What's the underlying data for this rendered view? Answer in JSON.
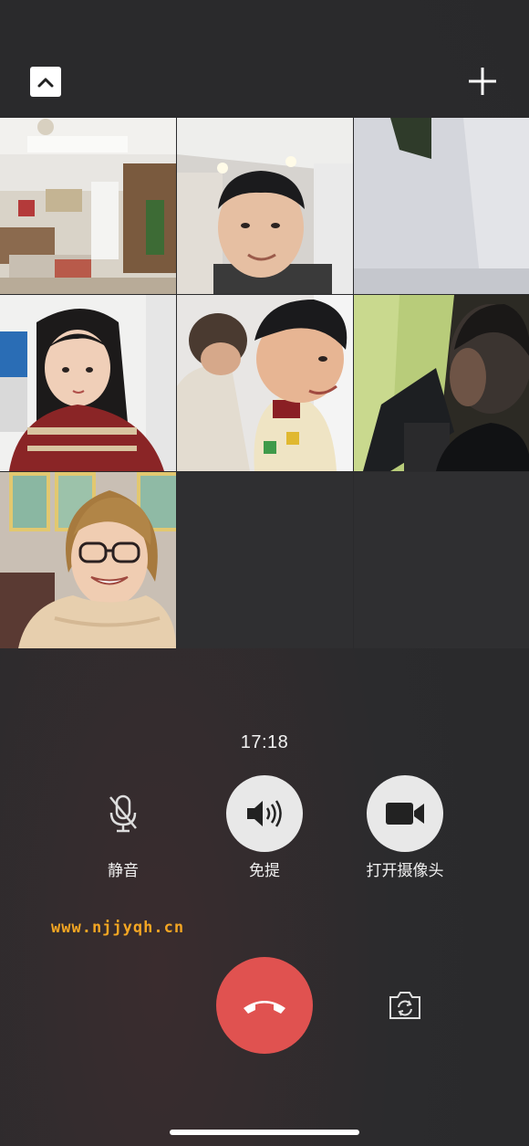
{
  "call": {
    "timer": "17:18"
  },
  "header": {
    "collapse_icon": "chevron-up-icon",
    "add_icon": "plus-icon"
  },
  "participants": [
    {
      "scene": "living-room"
    },
    {
      "scene": "boy-selfie"
    },
    {
      "scene": "white-wall"
    },
    {
      "scene": "girl-sweater"
    },
    {
      "scene": "boy-and-man"
    },
    {
      "scene": "man-dark-room"
    },
    {
      "scene": "woman-glasses"
    }
  ],
  "controls": {
    "mute": {
      "label": "静音",
      "icon": "microphone-icon"
    },
    "speaker": {
      "label": "免提",
      "icon": "speaker-icon"
    },
    "camera": {
      "label": "打开摄像头",
      "icon": "video-camera-icon"
    }
  },
  "watermark": "www.njjyqh.cn",
  "hangup_icon": "hang-up-icon",
  "flip_camera_icon": "flip-camera-icon",
  "colors": {
    "background": "#2b2b2d",
    "hangup": "#e05250",
    "watermark": "#f4a623"
  }
}
